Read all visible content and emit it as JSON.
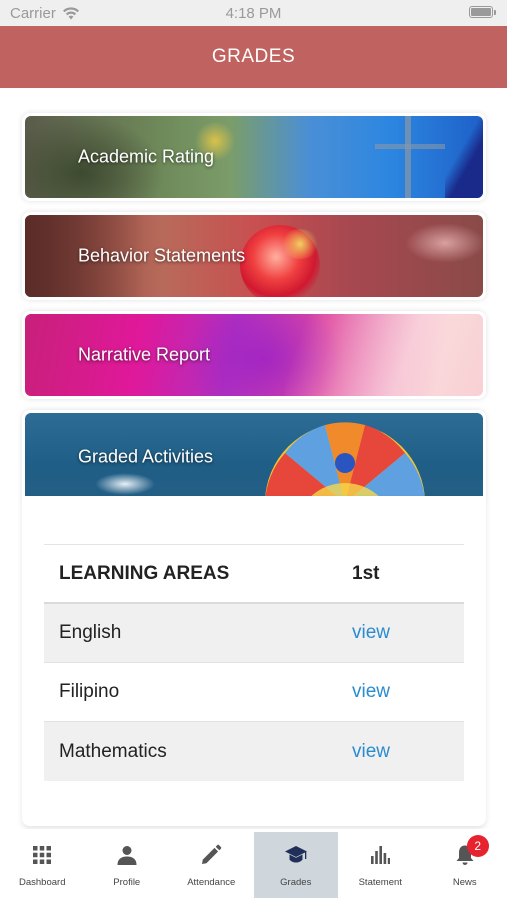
{
  "status_bar": {
    "carrier": "Carrier",
    "time": "4:18 PM",
    "icons": [
      "wifi-icon",
      "battery-icon"
    ]
  },
  "header": {
    "title": "GRADES",
    "color": "#c0625f"
  },
  "cards": [
    {
      "label": "Academic Rating"
    },
    {
      "label": "Behavior Statements"
    },
    {
      "label": "Narrative Report"
    },
    {
      "label": "Graded Activities"
    }
  ],
  "grades_table": {
    "headers": {
      "area": "LEARNING AREAS",
      "quarter": "1st"
    },
    "rows": [
      {
        "area": "English",
        "action": "view"
      },
      {
        "area": "Filipino",
        "action": "view"
      },
      {
        "area": "Mathematics",
        "action": "view"
      }
    ],
    "link_color": "#2a8ccf"
  },
  "tabbar": {
    "items": [
      {
        "label": "Dashboard",
        "icon": "grid-icon"
      },
      {
        "label": "Profile",
        "icon": "person-icon"
      },
      {
        "label": "Attendance",
        "icon": "pencil-icon"
      },
      {
        "label": "Grades",
        "icon": "graduation-cap-icon",
        "active": true
      },
      {
        "label": "Statement",
        "icon": "bar-chart-icon"
      },
      {
        "label": "News",
        "icon": "bell-icon",
        "badge": "2"
      }
    ],
    "active_bg": "#cfd6dc",
    "badge_color": "#e6232f"
  }
}
